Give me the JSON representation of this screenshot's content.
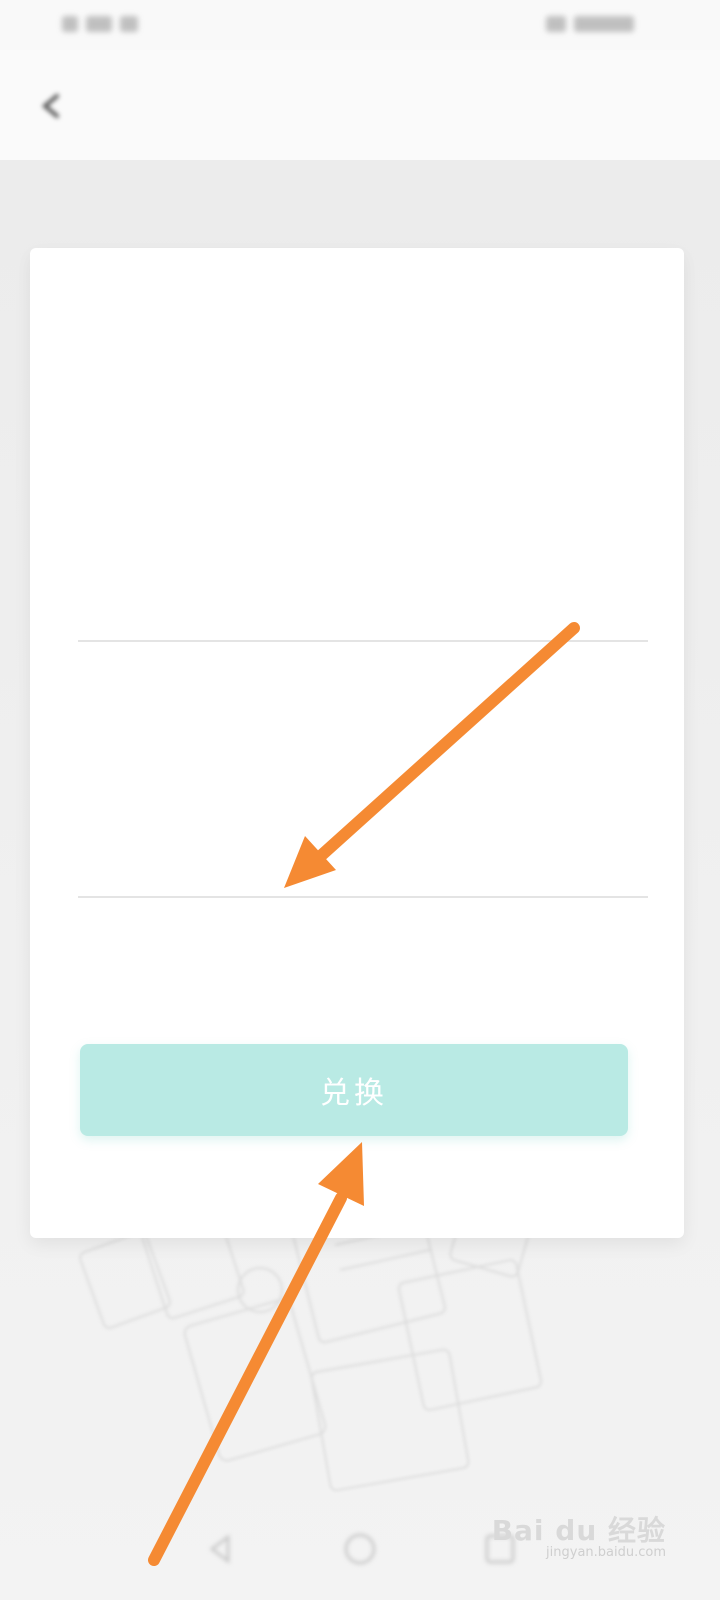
{
  "status_bar": {
    "left_text": "",
    "right_text": ""
  },
  "header": {
    "title": ""
  },
  "card": {
    "headline": "",
    "account_label": "",
    "account_value": "",
    "code_label": "",
    "code_value": "",
    "submit_label": "兑换"
  },
  "watermark": {
    "brand": "Bai du 经验",
    "url": "jingyan.baidu.com"
  },
  "colors": {
    "accent": "#5fd6c3",
    "button_bg": "#b9eae4",
    "arrow": "#f58a33",
    "background": "#ededed"
  },
  "icons": {
    "back": "back-arrow-icon",
    "nav_back": "nav-back-icon",
    "nav_home": "nav-home-icon",
    "nav_recent": "nav-recent-icon"
  }
}
